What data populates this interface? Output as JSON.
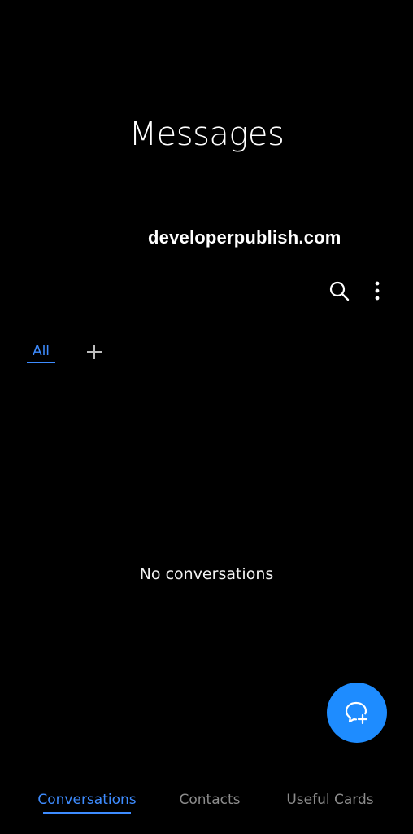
{
  "header": {
    "title": "Messages",
    "watermark": "developerpublish.com"
  },
  "toolbar": {
    "search_icon": "search-icon",
    "more_icon": "more-vertical-icon"
  },
  "category_tabs": {
    "active_label": "All",
    "add_icon": "plus-icon"
  },
  "main": {
    "empty_text": "No conversations"
  },
  "fab": {
    "icon": "new-message-icon",
    "color": "#1e8cff"
  },
  "bottom_nav": {
    "items": [
      {
        "label": "Conversations",
        "active": true
      },
      {
        "label": "Contacts",
        "active": false
      },
      {
        "label": "Useful Cards",
        "active": false
      }
    ]
  },
  "colors": {
    "background": "#000000",
    "accent": "#3e8cff",
    "inactive": "#8c8c8c"
  }
}
